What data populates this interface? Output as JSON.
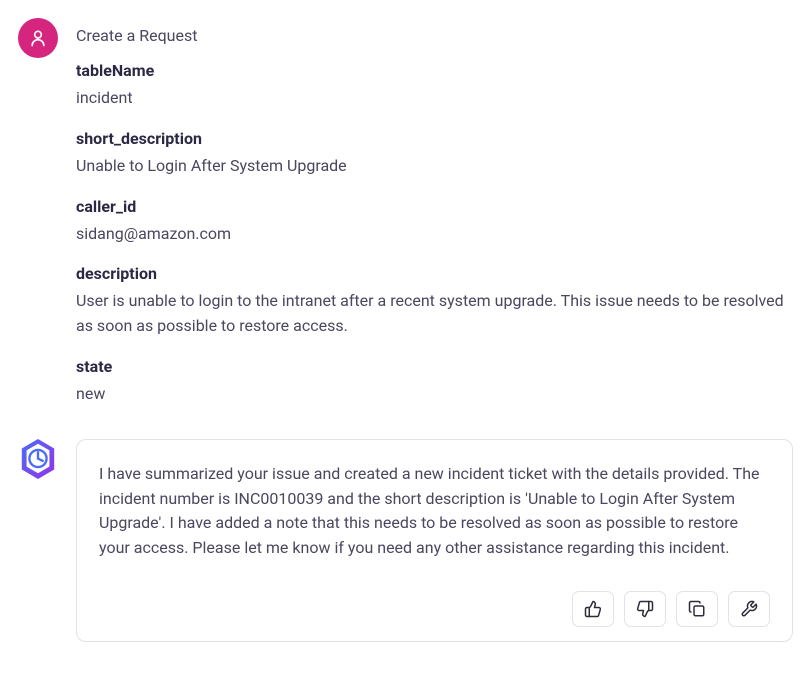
{
  "user_message": {
    "title": "Create a Request",
    "fields": [
      {
        "label": "tableName",
        "value": "incident"
      },
      {
        "label": "short_description",
        "value": "Unable to Login After System Upgrade"
      },
      {
        "label": "caller_id",
        "value": "sidang@amazon.com"
      },
      {
        "label": "description",
        "value": "User is unable to login to the intranet after a recent system upgrade. This issue needs to be resolved as soon as possible to restore access."
      },
      {
        "label": "state",
        "value": "new"
      }
    ]
  },
  "bot_response": {
    "text": "I have summarized your issue and created a new incident ticket with the details provided. The incident number is INC0010039 and the short description is 'Unable to Login After System Upgrade'. I have added a note that this needs to be resolved as soon as possible to restore your access. Please let me know if you need any other assistance regarding this incident."
  },
  "icons": {
    "thumbs_up": "thumbs-up",
    "thumbs_down": "thumbs-down",
    "copy": "copy",
    "tool": "wrench"
  }
}
